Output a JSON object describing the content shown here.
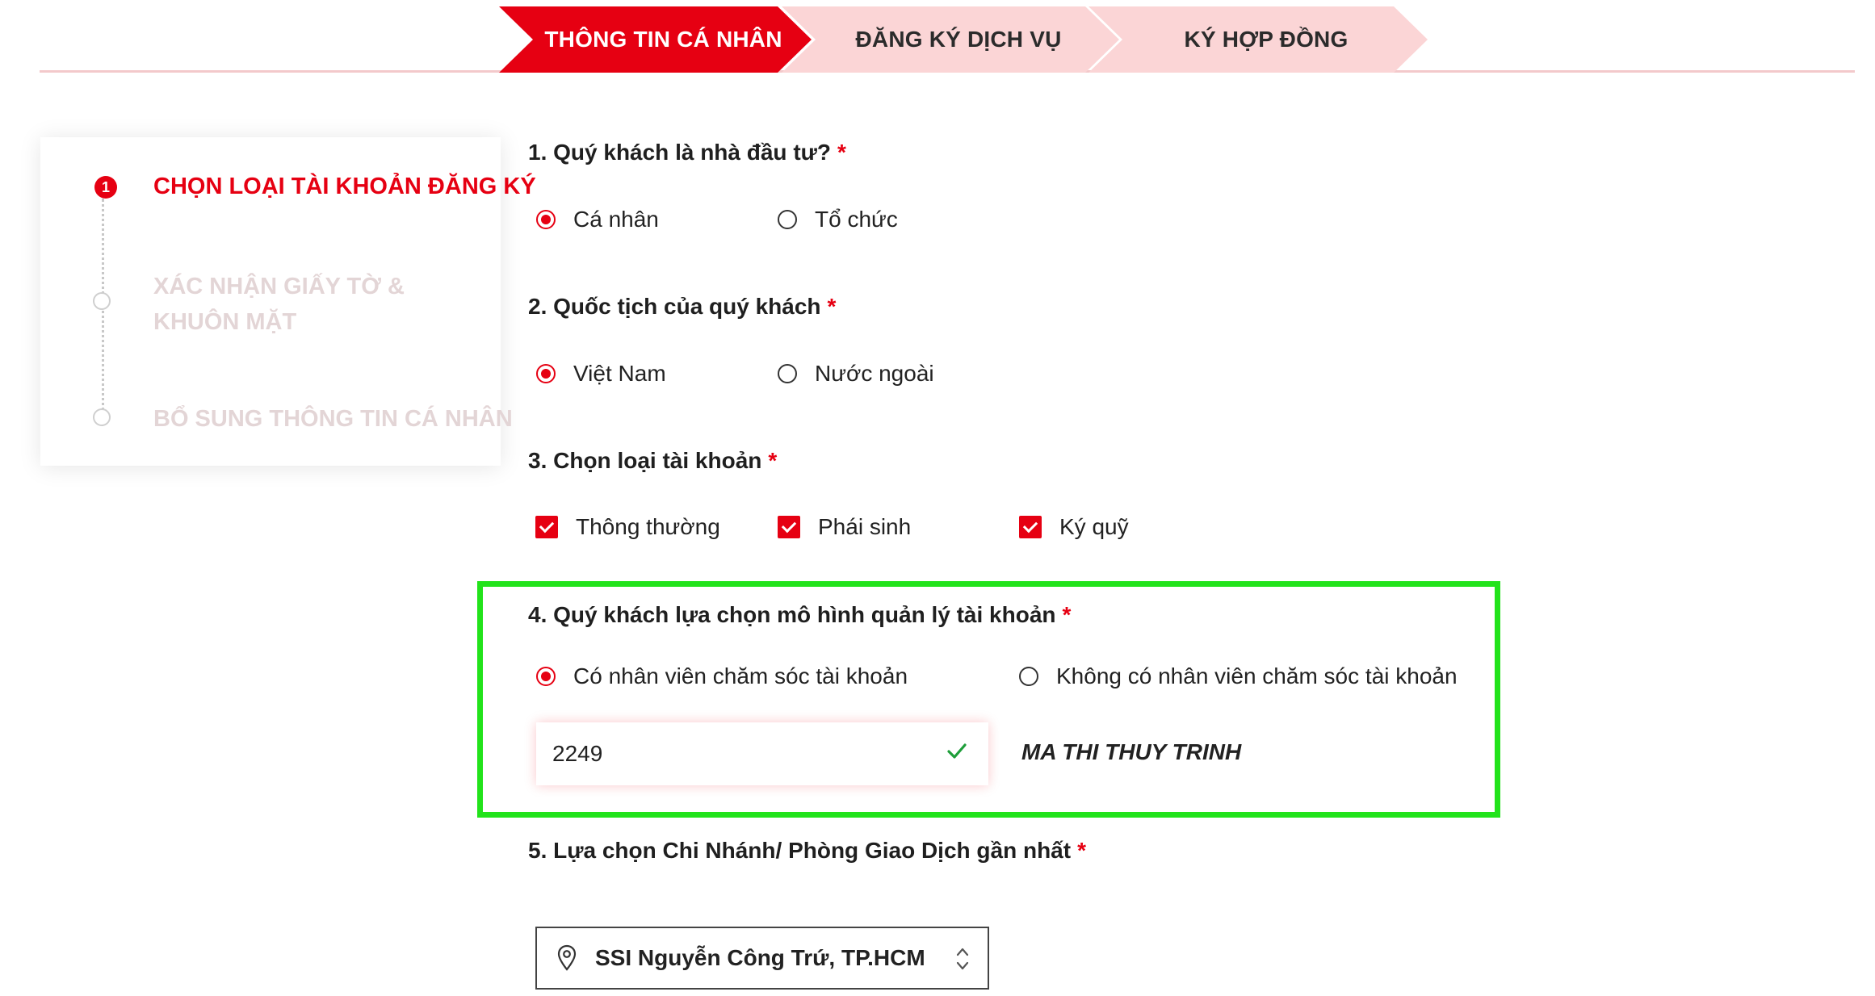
{
  "steps": [
    {
      "label": "THÔNG TIN CÁ NHÂN",
      "active": true
    },
    {
      "label": "ĐĂNG KÝ DỊCH VỤ",
      "active": false
    },
    {
      "label": "KÝ HỢP ĐỒNG",
      "active": false
    }
  ],
  "substeps": [
    {
      "number": "1",
      "label": "CHỌN LOẠI TÀI KHOẢN ĐĂNG KÝ",
      "active": true
    },
    {
      "label": "XÁC NHẬN GIẤY TỜ & KHUÔN MẶT",
      "active": false
    },
    {
      "label": "BỔ SUNG THÔNG TIN CÁ NHÂN",
      "active": false
    }
  ],
  "questions": {
    "q1": {
      "title": "1.  Quý khách là nhà đầu tư?",
      "required": "*",
      "options": [
        {
          "label": "Cá nhân",
          "selected": true
        },
        {
          "label": "Tổ chức",
          "selected": false
        }
      ]
    },
    "q2": {
      "title": "2.  Quốc tịch của quý khách",
      "required": "*",
      "options": [
        {
          "label": "Việt Nam",
          "selected": true
        },
        {
          "label": "Nước ngoài",
          "selected": false
        }
      ]
    },
    "q3": {
      "title": "3.  Chọn loại tài khoản",
      "required": "*",
      "options": [
        {
          "label": "Thông thường",
          "checked": true
        },
        {
          "label": "Phái sinh",
          "checked": true
        },
        {
          "label": "Ký quỹ",
          "checked": true
        }
      ]
    },
    "q4": {
      "title": "4.  Quý khách lựa chọn mô hình quản lý tài khoản",
      "required": "*",
      "options": [
        {
          "label": "Có nhân viên chăm sóc tài khoản",
          "selected": true
        },
        {
          "label": "Không có nhân viên chăm sóc tài khoản",
          "selected": false
        }
      ],
      "staff_code": "2249",
      "staff_name": "MA THI THUY TRINH"
    },
    "q5": {
      "title": "5.  Lựa chọn Chi Nhánh/ Phòng Giao Dịch gần nhất",
      "required": "*",
      "branch": "SSI Nguyễn Công Trứ, TP.HCM"
    }
  },
  "colors": {
    "accent": "#e60012",
    "highlight": "#22e31b",
    "inactive_step": "#fbd5d6"
  },
  "icons": {
    "valid": "check-icon",
    "branch": "location-pin-icon",
    "select": "chevron-updown-icon"
  }
}
